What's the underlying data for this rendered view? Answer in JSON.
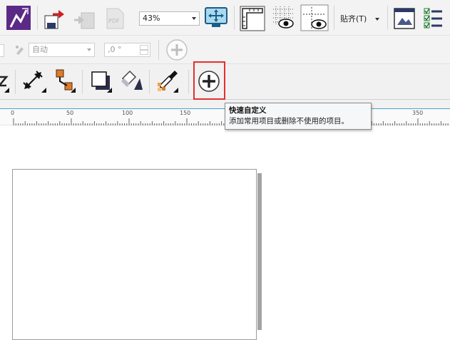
{
  "toolbar": {
    "zoom_value": "43%",
    "snap_label": "贴齐(T)"
  },
  "property_bar": {
    "fill_mode_value": "自动",
    "angle_value": ",0 °"
  },
  "ruler": {
    "labels": [
      "0",
      "50",
      "100",
      "150",
      "350"
    ]
  },
  "tooltip": {
    "title": "快速自定义",
    "description": "添加常用项目或删除不使用的项目。"
  },
  "colors": {
    "accent_purple": "#5b2a86",
    "highlight_red": "#e23030",
    "ruler_line": "#4aa0d0"
  },
  "icons": {
    "app_logo": "corel-logo-icon",
    "customize": "plus-circle-icon"
  }
}
